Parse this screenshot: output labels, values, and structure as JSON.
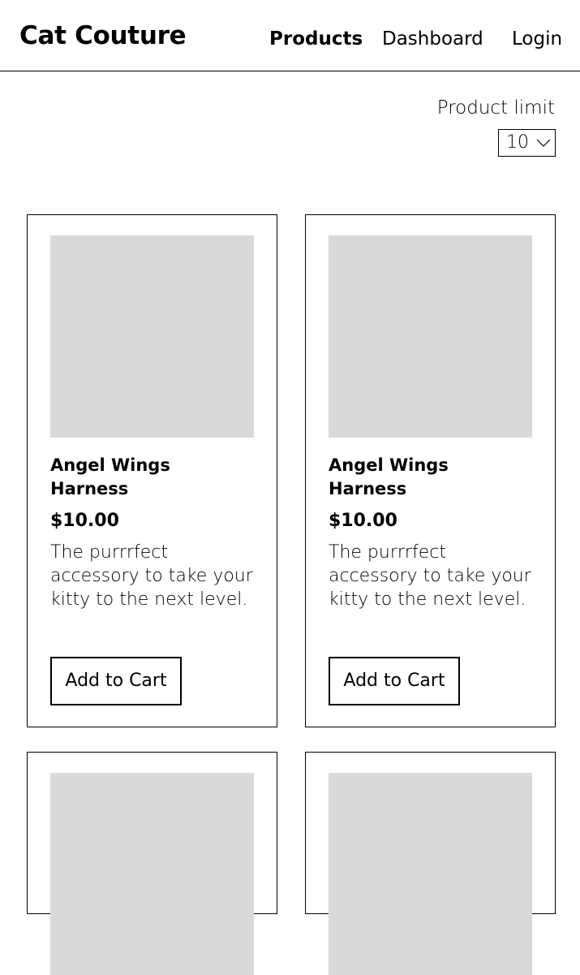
{
  "header": {
    "brand": "Cat Couture",
    "nav": {
      "products": "Products",
      "dashboard": "Dashboard",
      "login": "Login"
    }
  },
  "controls": {
    "product_limit_label": "Product limit",
    "product_limit_value": "10"
  },
  "products": [
    {
      "name": "Angel Wings Harness",
      "price": "$10.00",
      "description": "The purrrfect accessory to take your kitty to the next level.",
      "button_label": "Add to Cart"
    },
    {
      "name": "Angel Wings Harness",
      "price": "$10.00",
      "description": "The purrrfect accessory to take your kitty to the next level.",
      "button_label": "Add to Cart"
    }
  ],
  "colors": {
    "image_placeholder": "#d9d9d9",
    "border": "#000000",
    "text": "#000000",
    "background": "#ffffff"
  }
}
